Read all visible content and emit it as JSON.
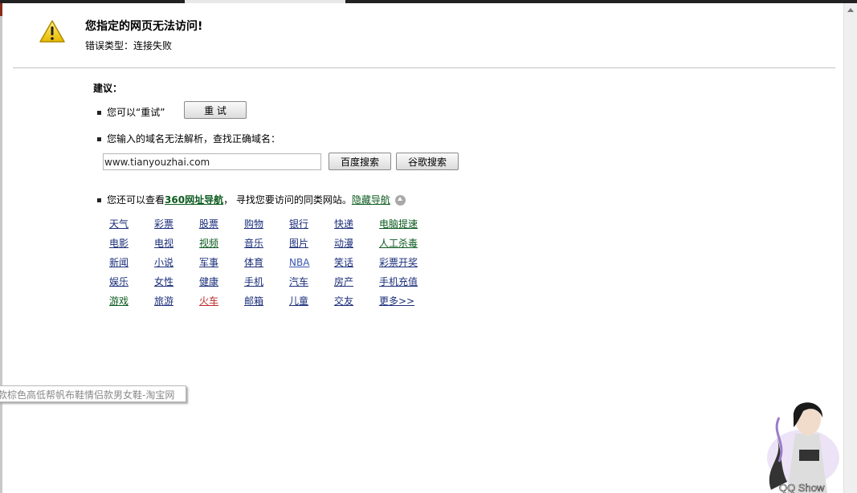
{
  "error": {
    "title": "您指定的网页无法访问!",
    "error_type": "错误类型：连接失败"
  },
  "suggestions": {
    "heading": "建议：",
    "retry_text": "您可以“重试”",
    "retry_button": "重 试",
    "domain_text": "您输入的域名无法解析，查找正确域名：",
    "domain_value": "www.tianyouzhai.com",
    "baidu_button": "百度搜索",
    "google_button": "谷歌搜索",
    "nav_prefix": "您还可以查看",
    "nav_link": "360网址导航",
    "nav_suffix": "， 寻找您要访问的同类网站。",
    "hide_nav": "隐藏导航"
  },
  "link_colors": {
    "default": "#1b2f7a",
    "green": "#0b5a1e",
    "red": "#c0282a",
    "light_blue": "#3b55b0"
  },
  "links": [
    [
      {
        "t": "天气"
      },
      {
        "t": "彩票"
      },
      {
        "t": "股票"
      },
      {
        "t": "购物"
      },
      {
        "t": "银行"
      },
      {
        "t": "快递"
      },
      {
        "t": "电脑提速",
        "c": "green"
      }
    ],
    [
      {
        "t": "电影"
      },
      {
        "t": "电视"
      },
      {
        "t": "视频",
        "c": "green"
      },
      {
        "t": "音乐"
      },
      {
        "t": "图片"
      },
      {
        "t": "动漫"
      },
      {
        "t": "人工杀毒",
        "c": "green"
      }
    ],
    [
      {
        "t": "新闻"
      },
      {
        "t": "小说"
      },
      {
        "t": "军事"
      },
      {
        "t": "体育"
      },
      {
        "t": "NBA",
        "c": "light_blue"
      },
      {
        "t": "笑话"
      },
      {
        "t": "彩票开奖"
      }
    ],
    [
      {
        "t": "娱乐"
      },
      {
        "t": "女性"
      },
      {
        "t": "健康"
      },
      {
        "t": "手机"
      },
      {
        "t": "汽车"
      },
      {
        "t": "房产"
      },
      {
        "t": "手机充值"
      }
    ],
    [
      {
        "t": "游戏",
        "c": "green"
      },
      {
        "t": "旅游"
      },
      {
        "t": "火车",
        "c": "red"
      },
      {
        "t": "邮箱"
      },
      {
        "t": "儿童"
      },
      {
        "t": "交友"
      },
      {
        "t": "更多>>"
      }
    ]
  ],
  "tooltip": "款棕色高低帮帆布鞋情侣款男女鞋-淘宝网",
  "qqshow": {
    "label": "QQ Show"
  }
}
